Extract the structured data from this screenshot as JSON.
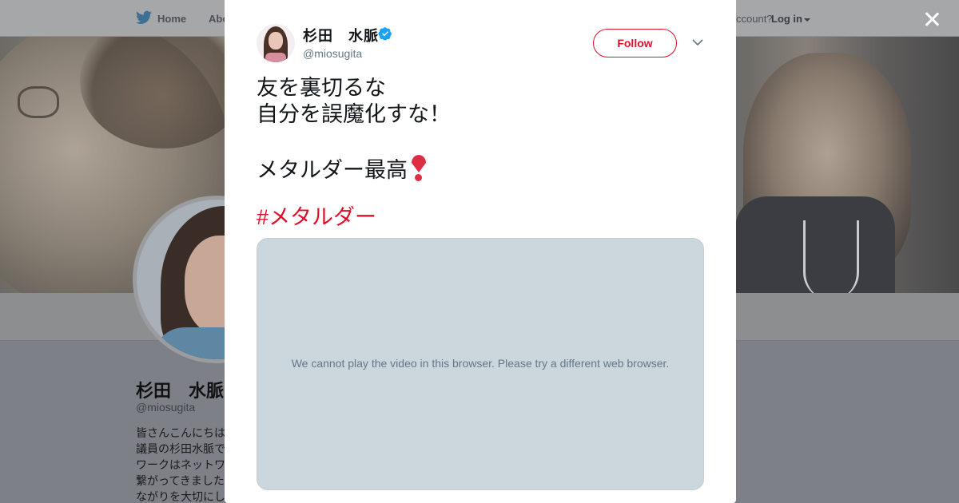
{
  "background_page": {
    "nav": {
      "home_label": "Home",
      "about_label": "Abo",
      "account_question": "ccount?",
      "login_label": "Log in"
    },
    "profile": {
      "name": "杉田　水脈",
      "handle": "@miosugita",
      "bio": "皆さんこんにちは\n議員の杉田水脈で\nワークはネットワ\n繋がってきました\nながりを大切にし"
    }
  },
  "tweet": {
    "author_name": "杉田　水脈",
    "author_handle": "@miosugita",
    "follow_label": "Follow",
    "text_lines": [
      "友を裏切るな",
      "自分を誤魔化すな！",
      "",
      "メタルダー最高"
    ],
    "hashtag": "#メタルダー",
    "video_message": "We cannot play the video in this browser. Please try a different web browser."
  },
  "icons": {
    "close": "close-icon",
    "verified": "verified-badge-icon",
    "menu": "chevron-down-icon",
    "twitter": "twitter-bird-icon",
    "exclamation": "heavy-heart-exclamation-icon"
  },
  "colors": {
    "accent": "#e0102a",
    "verified": "#1da1f2",
    "video_placeholder": "#ccd6dd"
  }
}
